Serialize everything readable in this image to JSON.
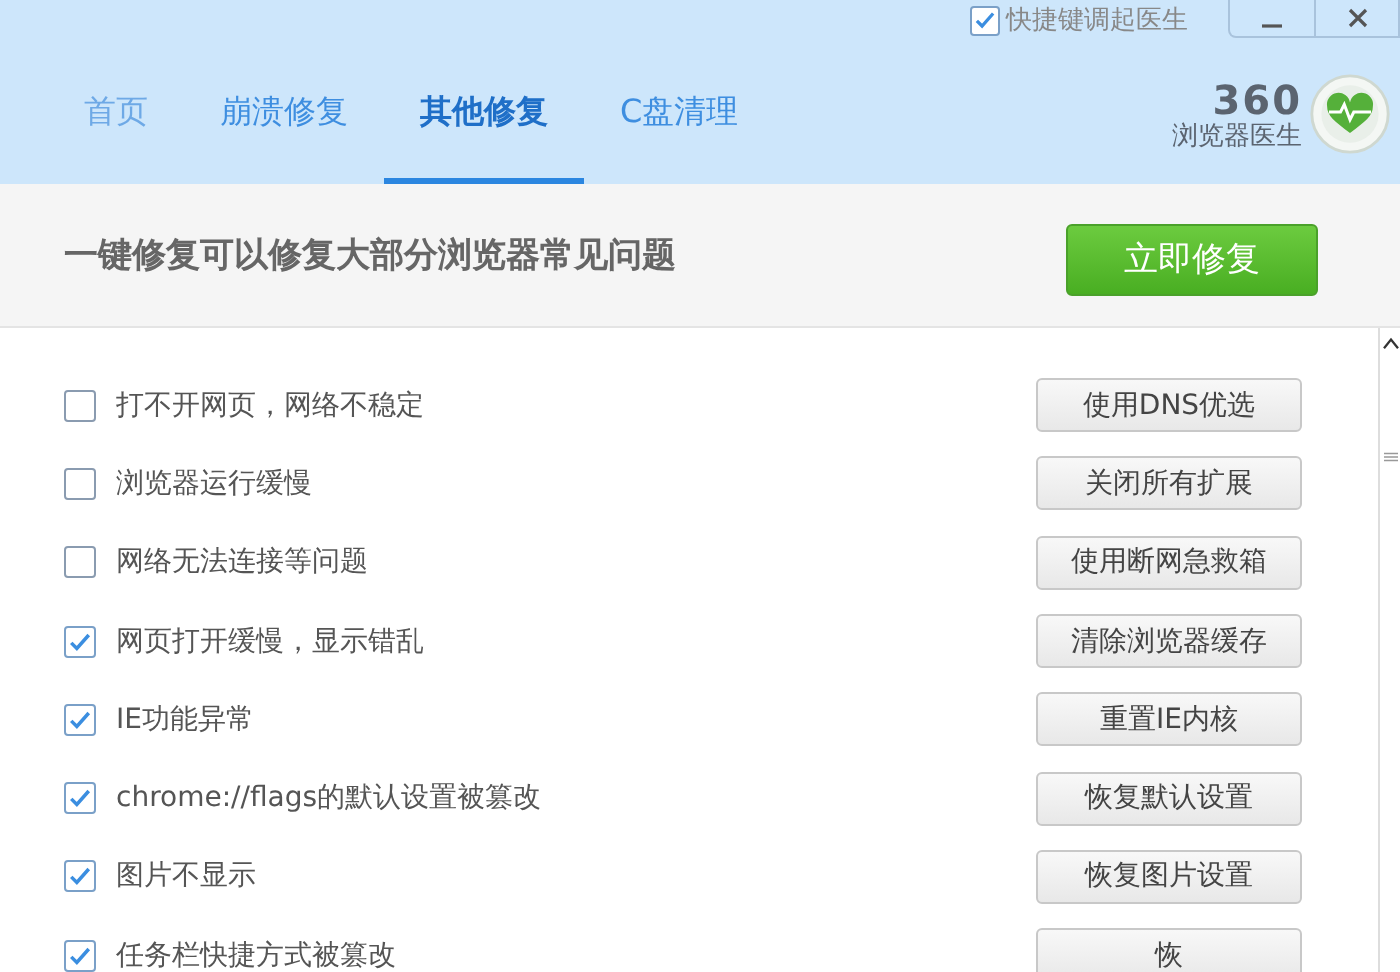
{
  "title_bar": {
    "hotkey_option": {
      "label": "快捷键调起医生",
      "checked": true
    }
  },
  "tabs": [
    {
      "label": "首页",
      "selected": false
    },
    {
      "label": "崩溃修复",
      "selected": false
    },
    {
      "label": "其他修复",
      "selected": true
    },
    {
      "label": "C盘清理",
      "selected": false
    }
  ],
  "logo": {
    "number": "360",
    "name": "浏览器医生"
  },
  "banner": {
    "text": "一键修复可以修复大部分浏览器常见问题",
    "button": "立即修复"
  },
  "issues": [
    {
      "label": "打不开网页，网络不稳定",
      "checked": false,
      "action": "使用DNS优选"
    },
    {
      "label": "浏览器运行缓慢",
      "checked": false,
      "action": "关闭所有扩展"
    },
    {
      "label": "网络无法连接等问题",
      "checked": false,
      "action": "使用断网急救箱"
    },
    {
      "label": "网页打开缓慢，显示错乱",
      "checked": true,
      "action": "清除浏览器缓存"
    },
    {
      "label": "IE功能异常",
      "checked": true,
      "action": "重置IE内核"
    },
    {
      "label": "chrome://flags的默认设置被篡改",
      "checked": true,
      "action": "恢复默认设置"
    },
    {
      "label": "图片不显示",
      "checked": true,
      "action": "恢复图片设置"
    },
    {
      "label": "任务栏快捷方式被篡改",
      "checked": true,
      "action": "恢"
    }
  ]
}
